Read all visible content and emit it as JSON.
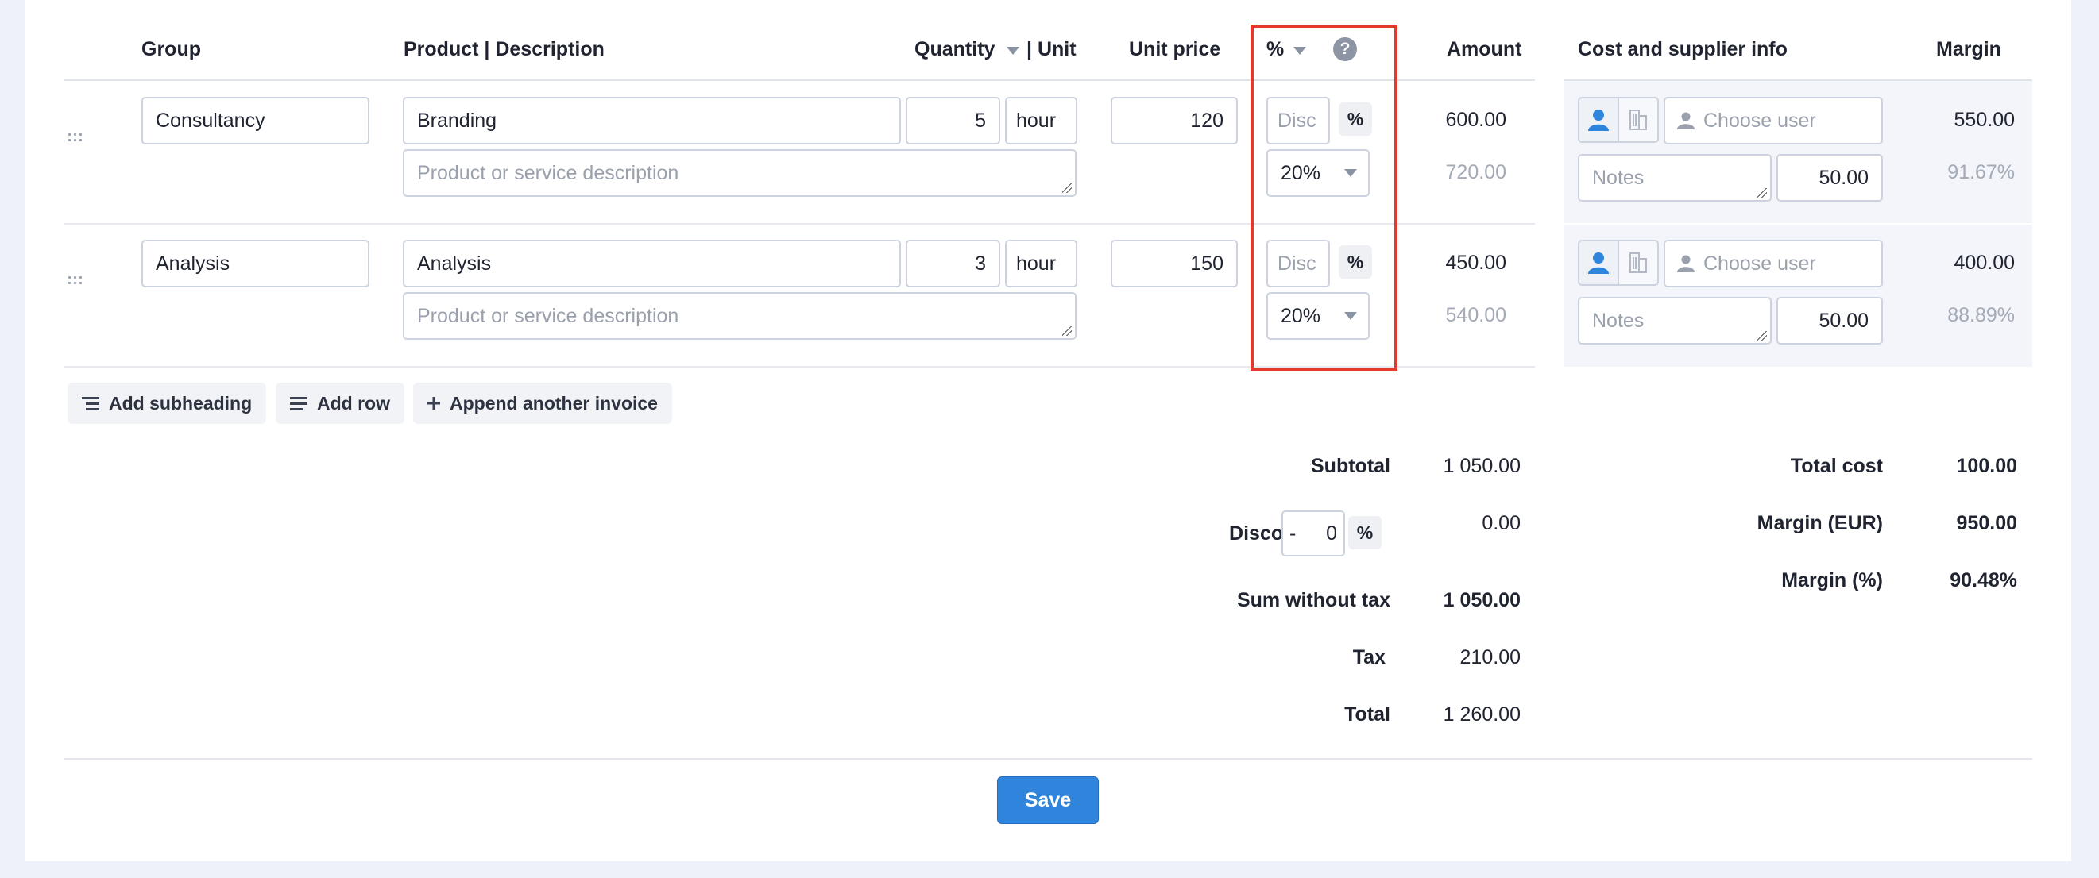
{
  "headers": {
    "group": "Group",
    "product": "Product | Description",
    "quantity": "Quantity",
    "unit_sep": "| Unit",
    "unit_price": "Unit price",
    "percent": "%",
    "amount": "Amount",
    "cost_info": "Cost and supplier info",
    "margin": "Margin"
  },
  "rows": [
    {
      "group": "Consultancy",
      "product": "Branding",
      "description_placeholder": "Product or service description",
      "quantity": "5",
      "unit": "hour",
      "unit_price": "120",
      "discount_placeholder": "Disc",
      "discount_unit": "%",
      "vat": "20%",
      "amount": "600.00",
      "amount_with_tax": "720.00",
      "supplier_placeholder": "Choose user",
      "notes_placeholder": "Notes",
      "cost": "50.00",
      "margin": "550.00",
      "margin_pct": "91.67%"
    },
    {
      "group": "Analysis",
      "product": "Analysis",
      "description_placeholder": "Product or service description",
      "quantity": "3",
      "unit": "hour",
      "unit_price": "150",
      "discount_placeholder": "Disc",
      "discount_unit": "%",
      "vat": "20%",
      "amount": "450.00",
      "amount_with_tax": "540.00",
      "supplier_placeholder": "Choose user",
      "notes_placeholder": "Notes",
      "cost": "50.00",
      "margin": "400.00",
      "margin_pct": "88.89%"
    }
  ],
  "actions": {
    "add_subheading": "Add subheading",
    "add_row": "Add row",
    "append_invoice": "Append another invoice"
  },
  "totals": {
    "subtotal_label": "Subtotal",
    "subtotal": "1 050.00",
    "discount_label": "Discount",
    "discount_sign": "-",
    "discount_value": "0",
    "discount_unit": "%",
    "discount_amount": "0.00",
    "sum_label": "Sum without tax",
    "sum": "1 050.00",
    "tax_label": "Tax",
    "tax": "210.00",
    "total_label": "Total",
    "total": "1 260.00"
  },
  "margin_summary": {
    "total_cost_label": "Total cost",
    "total_cost": "100.00",
    "margin_eur_label": "Margin (EUR)",
    "margin_eur": "950.00",
    "margin_pct_label": "Margin (%)",
    "margin_pct": "90.48%"
  },
  "save_label": "Save",
  "colors": {
    "accent": "#2f84db",
    "highlight": "#e23a2c",
    "background": "#eef0fa"
  }
}
